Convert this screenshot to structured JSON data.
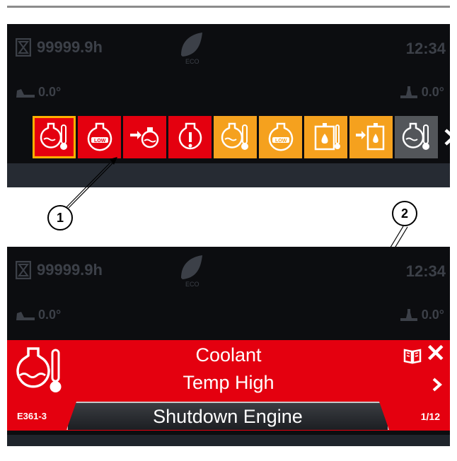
{
  "panel1": {
    "hours": "99999.9h",
    "clock": "12:34",
    "eco_label": "ECO",
    "tilt_left": "0.0°",
    "tilt_right": "0.0°",
    "icons": [
      {
        "name": "coolant-temp-red-icon",
        "color": "#e4000f"
      },
      {
        "name": "coolant-level-low-red-icon",
        "color": "#e4000f"
      },
      {
        "name": "hydraulic-pressure-red-icon",
        "color": "#e4000f"
      },
      {
        "name": "warning-red-icon",
        "color": "#e4000f"
      },
      {
        "name": "coolant-temp-orange-icon",
        "color": "#f5a11e"
      },
      {
        "name": "coolant-level-low-orange-icon",
        "color": "#f5a11e"
      },
      {
        "name": "hydraulic-tank-orange-icon",
        "color": "#f5a11e"
      },
      {
        "name": "hydraulic-filter-orange-icon",
        "color": "#f5a11e"
      },
      {
        "name": "coolant-temp-gray-icon",
        "color": "#53565a"
      }
    ]
  },
  "callouts": [
    "1",
    "2"
  ],
  "panel2": {
    "hours": "99999.9h",
    "clock": "12:34",
    "eco_label": "ECO",
    "tilt_left": "0.0°",
    "tilt_right": "0.0°"
  },
  "alert": {
    "title_line1": "Coolant",
    "title_line2": "Temp High",
    "action": "Shutdown Engine",
    "code": "E361-3",
    "count": "1/12"
  },
  "colors": {
    "alert_red": "#e4000f",
    "warning_orange": "#f5a11e",
    "panel_bg": "#0c0d10"
  }
}
